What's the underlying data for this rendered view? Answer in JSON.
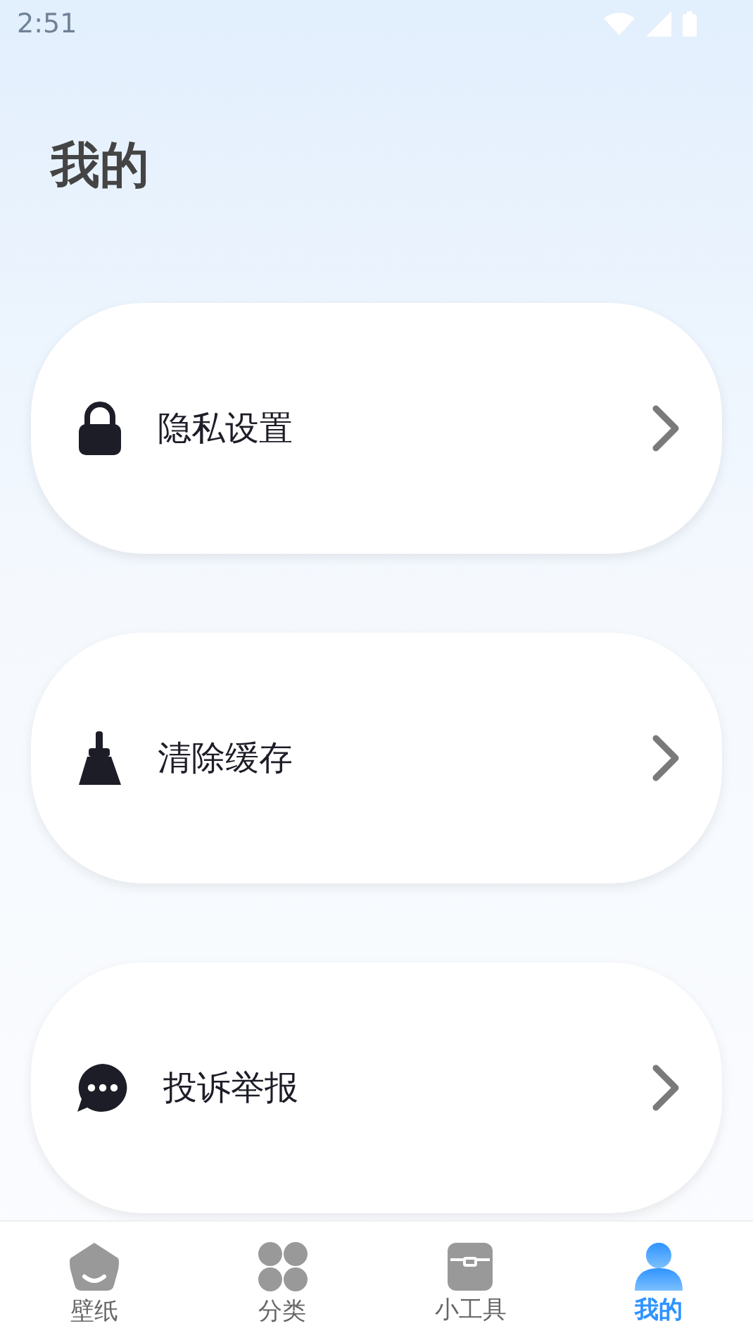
{
  "status_bar": {
    "time": "2:51"
  },
  "title": "我的",
  "menu": [
    {
      "label": "隐私设置",
      "kind": "lock"
    },
    {
      "label": "清除缓存",
      "kind": "broom"
    },
    {
      "label": "投诉举报",
      "kind": "chat"
    }
  ],
  "nav": [
    {
      "label": "壁纸",
      "kind": "wallpaper",
      "selected": false
    },
    {
      "label": "分类",
      "kind": "category",
      "selected": false
    },
    {
      "label": "小工具",
      "kind": "tools",
      "selected": false
    },
    {
      "label": "我的",
      "kind": "profile",
      "selected": true
    }
  ]
}
